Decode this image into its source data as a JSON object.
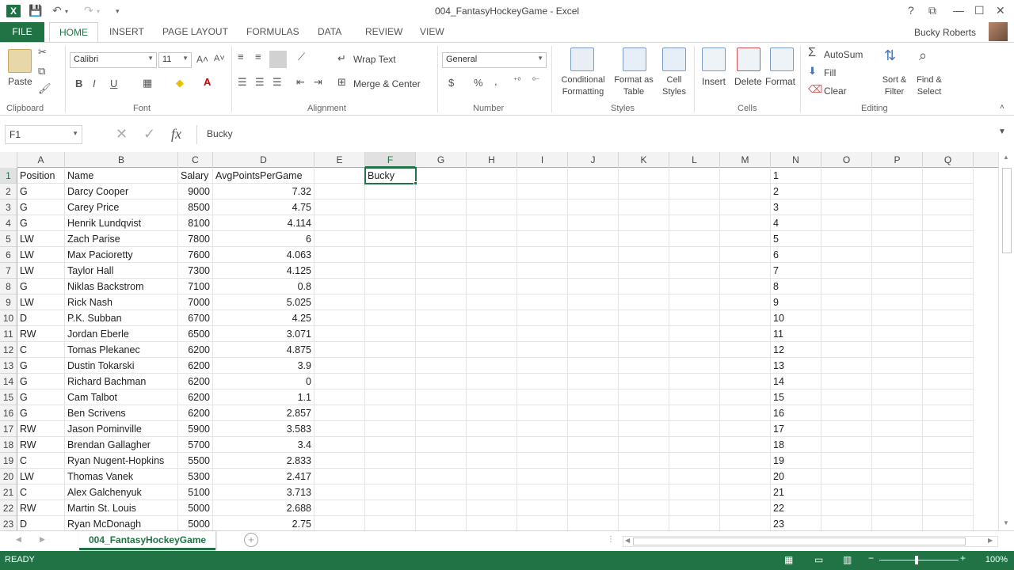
{
  "window": {
    "title": "004_FantasyHockeyGame - Excel",
    "user": "Bucky Roberts"
  },
  "quick_access": {
    "save_icon": "save-icon",
    "undo_icon": "undo-icon",
    "redo_icon": "redo-icon"
  },
  "title_controls": [
    "?",
    "⧉",
    "—",
    "☐",
    "✕"
  ],
  "tabs": [
    "FILE",
    "HOME",
    "INSERT",
    "PAGE LAYOUT",
    "FORMULAS",
    "DATA",
    "REVIEW",
    "VIEW"
  ],
  "ribbon": {
    "clipboard": {
      "label": "Clipboard",
      "paste": "Paste"
    },
    "font": {
      "label": "Font",
      "name": "Calibri",
      "size": "11",
      "bold": "B",
      "italic": "I",
      "underline": "U"
    },
    "alignment": {
      "label": "Alignment",
      "wrap": "Wrap Text",
      "merge": "Merge & Center"
    },
    "number": {
      "label": "Number",
      "format": "General",
      "currency": "$",
      "percent": "%",
      "comma": ","
    },
    "styles": {
      "label": "Styles",
      "conditional": [
        "Conditional",
        "Formatting"
      ],
      "format_table": [
        "Format as",
        "Table"
      ],
      "cell_styles": [
        "Cell",
        "Styles"
      ]
    },
    "cells": {
      "label": "Cells",
      "insert": "Insert",
      "delete": "Delete",
      "format": "Format"
    },
    "editing": {
      "label": "Editing",
      "autosum": "AutoSum",
      "fill": "Fill",
      "clear": "Clear",
      "sort": [
        "Sort &",
        "Filter"
      ],
      "find": [
        "Find &",
        "Select"
      ]
    }
  },
  "formula_bar": {
    "name_box": "F1",
    "cancel": "✕",
    "enter": "✓",
    "fx": "fx",
    "content": "Bucky"
  },
  "grid": {
    "columns": [
      "A",
      "B",
      "C",
      "D",
      "E",
      "F",
      "G",
      "H",
      "I",
      "J",
      "K",
      "L",
      "M",
      "N",
      "O",
      "P",
      "Q"
    ],
    "active_column": "F",
    "active_row": "1",
    "rows": [
      {
        "n": "1",
        "a": "Position",
        "b": "Name",
        "c": "Salary",
        "d": "AvgPointsPerGame",
        "f": "Bucky"
      },
      {
        "n": "2",
        "a": "G",
        "b": "Darcy Cooper",
        "c": "9000",
        "d": "7.32"
      },
      {
        "n": "3",
        "a": "G",
        "b": "Carey Price",
        "c": "8500",
        "d": "4.75"
      },
      {
        "n": "4",
        "a": "G",
        "b": "Henrik Lundqvist",
        "c": "8100",
        "d": "4.114"
      },
      {
        "n": "5",
        "a": "LW",
        "b": "Zach Parise",
        "c": "7800",
        "d": "6"
      },
      {
        "n": "6",
        "a": "LW",
        "b": "Max Pacioretty",
        "c": "7600",
        "d": "4.063"
      },
      {
        "n": "7",
        "a": "LW",
        "b": "Taylor Hall",
        "c": "7300",
        "d": "4.125"
      },
      {
        "n": "8",
        "a": "G",
        "b": "Niklas Backstrom",
        "c": "7100",
        "d": "0.8"
      },
      {
        "n": "9",
        "a": "LW",
        "b": "Rick Nash",
        "c": "7000",
        "d": "5.025"
      },
      {
        "n": "10",
        "a": "D",
        "b": "P.K. Subban",
        "c": "6700",
        "d": "4.25"
      },
      {
        "n": "11",
        "a": "RW",
        "b": "Jordan Eberle",
        "c": "6500",
        "d": "3.071"
      },
      {
        "n": "12",
        "a": "C",
        "b": "Tomas Plekanec",
        "c": "6200",
        "d": "4.875"
      },
      {
        "n": "13",
        "a": "G",
        "b": "Dustin Tokarski",
        "c": "6200",
        "d": "3.9"
      },
      {
        "n": "14",
        "a": "G",
        "b": "Richard Bachman",
        "c": "6200",
        "d": "0"
      },
      {
        "n": "15",
        "a": "G",
        "b": "Cam Talbot",
        "c": "6200",
        "d": "1.1"
      },
      {
        "n": "16",
        "a": "G",
        "b": "Ben Scrivens",
        "c": "6200",
        "d": "2.857"
      },
      {
        "n": "17",
        "a": "RW",
        "b": "Jason Pominville",
        "c": "5900",
        "d": "3.583"
      },
      {
        "n": "18",
        "a": "RW",
        "b": "Brendan Gallagher",
        "c": "5700",
        "d": "3.4"
      },
      {
        "n": "19",
        "a": "C",
        "b": "Ryan Nugent-Hopkins",
        "c": "5500",
        "d": "2.833"
      },
      {
        "n": "20",
        "a": "LW",
        "b": "Thomas Vanek",
        "c": "5300",
        "d": "2.417"
      },
      {
        "n": "21",
        "a": "C",
        "b": "Alex Galchenyuk",
        "c": "5100",
        "d": "3.713"
      },
      {
        "n": "22",
        "a": "RW",
        "b": "Martin St. Louis",
        "c": "5000",
        "d": "2.688"
      },
      {
        "n": "23",
        "a": "D",
        "b": "Ryan McDonagh",
        "c": "5000",
        "d": "2.75"
      }
    ]
  },
  "sheet": {
    "tab": "004_FantasyHockeyGame",
    "add": "+"
  },
  "status": {
    "text": "READY",
    "zoom": "100%",
    "zoom_minus": "−",
    "zoom_plus": "+"
  },
  "colors": {
    "accent": "#217346",
    "header_bg": "#f3f3f3"
  }
}
